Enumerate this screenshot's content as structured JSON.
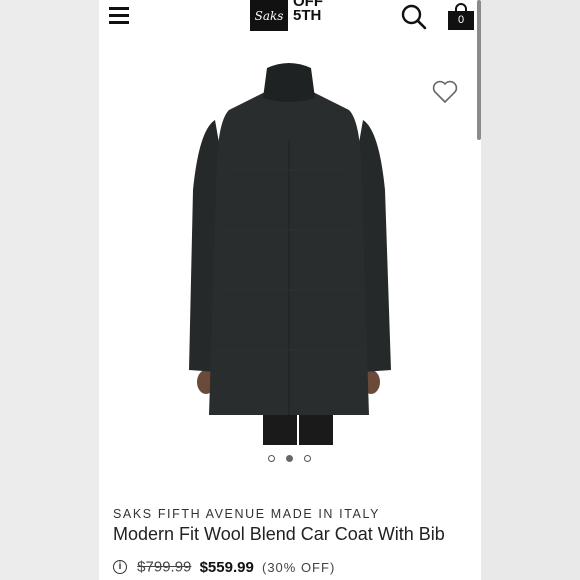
{
  "header": {
    "logo_script": "Saks",
    "logo_line1": "OFF",
    "logo_line2": "5TH",
    "bag_count": "0"
  },
  "icons": {
    "menu": "menu-icon",
    "search": "search-icon",
    "bag": "shopping-bag-icon",
    "wishlist": "heart-icon",
    "info": "info-icon"
  },
  "carousel": {
    "dot_count": 3,
    "active_index": 1
  },
  "product": {
    "brand": "SAKS FIFTH AVENUE MADE IN ITALY",
    "title": "Modern Fit Wool Blend Car Coat With Bib",
    "original_price": "$799.99",
    "sale_price": "$559.99",
    "discount": "(30% OFF)"
  },
  "colors": {
    "brand_black": "#111111",
    "coat": "#2a2d2e"
  }
}
